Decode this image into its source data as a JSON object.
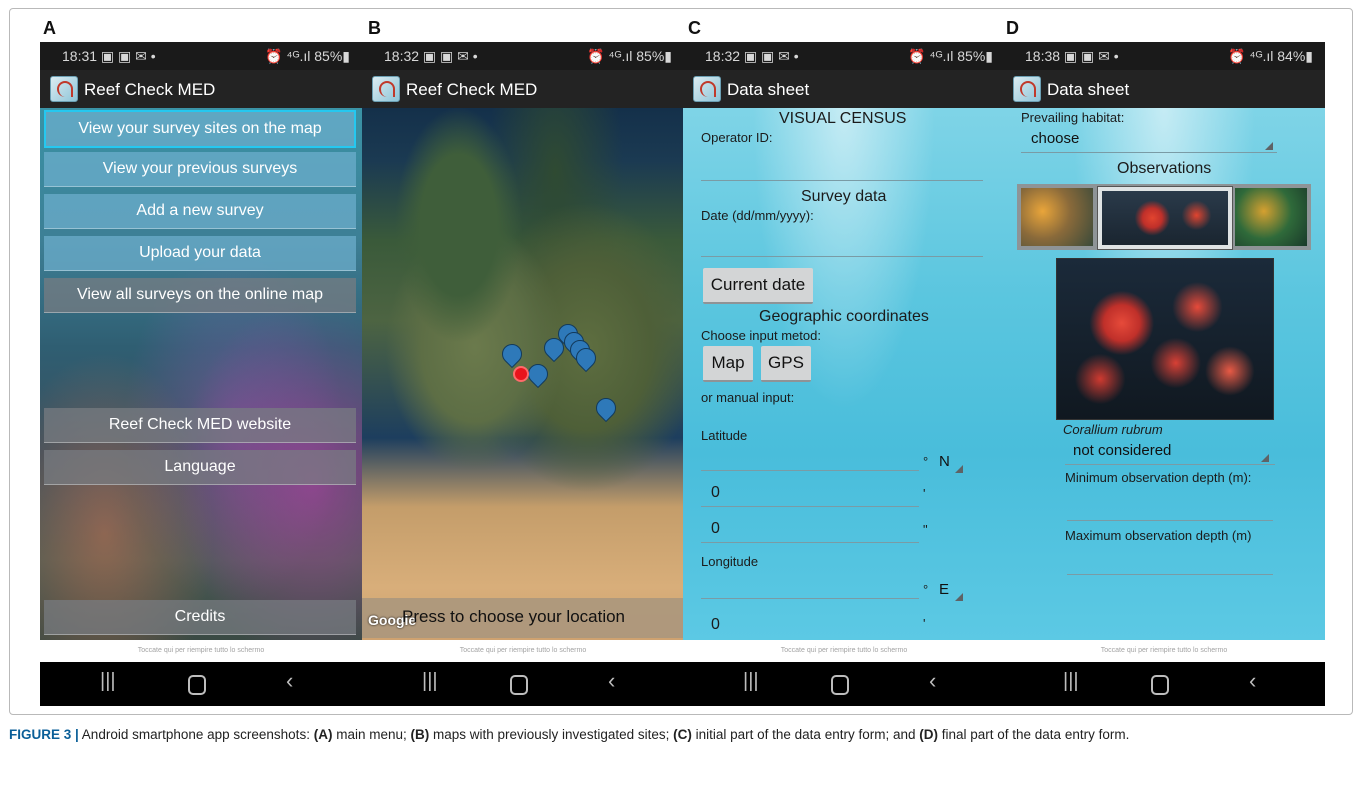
{
  "panel_labels": [
    "A",
    "B",
    "C",
    "D"
  ],
  "screens": {
    "a": {
      "time": "18:31",
      "status_right": "85%",
      "app_title": "Reef Check MED",
      "menu": [
        "View your survey sites on the map",
        "View your previous surveys",
        "Add a new survey",
        "Upload your data",
        "View all surveys on the online map"
      ],
      "menu_lower": [
        "Reef Check MED website",
        "Language"
      ],
      "credits": "Credits",
      "hint": "Toccate qui per riempire tutto lo schermo"
    },
    "b": {
      "time": "18:32",
      "status_right": "85%",
      "app_title": "Reef Check MED",
      "google": "Google",
      "press_label": "Press to choose your location",
      "hint": "Toccate qui per riempire tutto lo schermo"
    },
    "c": {
      "time": "18:32",
      "status_right": "85%",
      "app_title": "Data sheet",
      "visual_census": "VISUAL CENSUS",
      "operator_id": "Operator ID:",
      "survey_data": "Survey data",
      "date_label": "Date (dd/mm/yyyy):",
      "current_date_btn": "Current date",
      "geo_coords": "Geographic coordinates",
      "choose_method": "Choose input metod:",
      "map_btn": "Map",
      "gps_btn": "GPS",
      "manual_input": "or manual input:",
      "latitude": "Latitude",
      "lat_deg_unit": "°",
      "lat_dir": "N",
      "lat_min_value": "0",
      "lat_min_unit": "'",
      "lat_sec_value": "0",
      "lat_sec_unit": "\"",
      "longitude": "Longitude",
      "lon_deg_unit": "°",
      "lon_dir": "E",
      "lon_min_value": "0",
      "lon_min_unit": "'",
      "hint": "Toccate qui per riempire tutto lo schermo"
    },
    "d": {
      "time": "18:38",
      "status_right": "84%",
      "app_title": "Data sheet",
      "prevailing_habitat": "Prevailing habitat:",
      "habitat_value": "choose",
      "observations": "Observations",
      "species": "Corallium rubrum",
      "species_value": "not considered",
      "min_depth": "Minimum observation depth (m):",
      "max_depth": "Maximum observation depth (m)",
      "hint": "Toccate qui per riempire tutto lo schermo"
    }
  },
  "caption": {
    "label": "FIGURE 3 |",
    "parts": [
      " Android smartphone app screenshots: ",
      "(A)",
      " main menu; ",
      "(B)",
      " maps with previously investigated sites; ",
      "(C)",
      " initial part of the data entry form; and ",
      "(D)",
      " final part of the data entry form."
    ]
  }
}
